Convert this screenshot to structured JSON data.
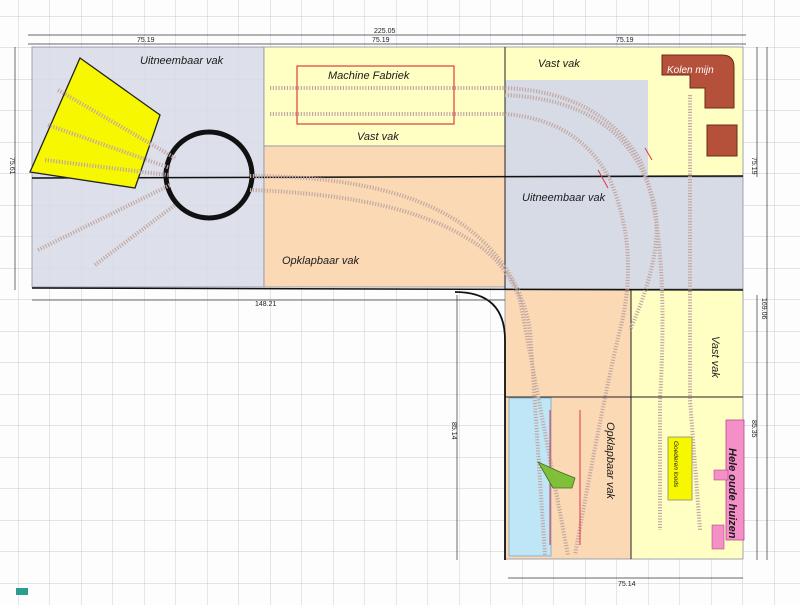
{
  "sections": {
    "uitneembaar_left": "Uitneembaar vak",
    "machine_fabriek": "Machine Fabriek",
    "vast_top_middle": "Vast vak",
    "vast_top_right": "Vast  vak",
    "kolen_mijn": "Kolen mijn",
    "uitneembaar_right": "Uitneembaar vak",
    "opklapbaar_middle": "Opklapbaar vak",
    "opklapbaar_lower": "Opklapbaar vak",
    "vast_right_lower": "Vast  vak",
    "goederen_loods": "Goederen loods",
    "hele_oude_huizen": "Hele oude huizen"
  },
  "dimensions": {
    "total_top": "225.05",
    "top_left": "75.19",
    "top_middle": "75.19",
    "top_right": "75.19",
    "left_side": "75.61",
    "right_side_upper": "75.19",
    "middle_horizontal": "148.21",
    "right_side_total": "169.06",
    "lower_middle_vertical": "85.14",
    "right_side_lower": "85.35",
    "bottom": "75.14"
  },
  "colors": {
    "grey_section": "#d7dbe6",
    "yellow_section": "#ffffc4",
    "orange_section": "#fbd9b4",
    "blue_section": "#bfe6f7",
    "pink_building": "#f58fc8",
    "brown_building": "#b5503a",
    "yellow_fan": "#f7f700",
    "track": "#c2a8a3"
  }
}
